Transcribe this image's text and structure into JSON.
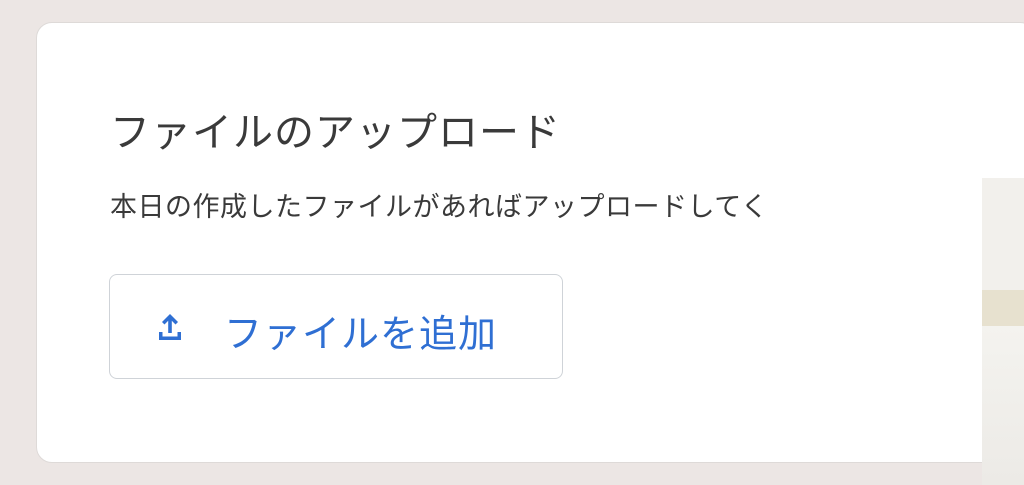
{
  "upload_card": {
    "title": "ファイルのアップロード",
    "description": "本日の作成したファイルがあればアップロードしてく",
    "add_file_button": {
      "label": "ファイルを追加",
      "icon": "upload-icon"
    }
  },
  "colors": {
    "background": "#ece6e4",
    "card": "#ffffff",
    "accent": "#2f6fd3",
    "text": "#3a3a3a"
  }
}
